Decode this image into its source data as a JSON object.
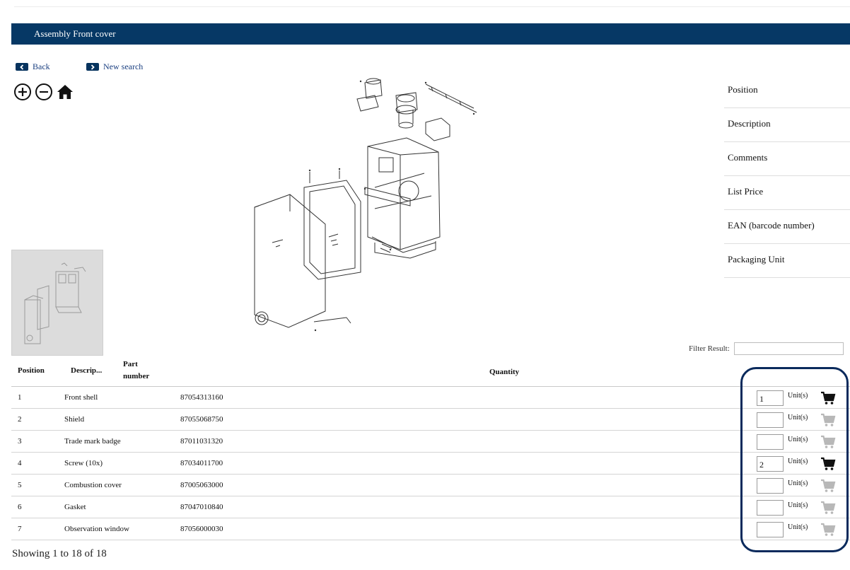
{
  "header": {
    "title": "Assembly Front cover"
  },
  "nav": {
    "back_label": "Back",
    "new_search_label": "New search"
  },
  "toolbar": {
    "zoom_in_icon": "circle-plus-icon",
    "zoom_out_icon": "circle-minus-icon",
    "home_icon": "home-icon"
  },
  "details": {
    "labels": [
      "Position",
      "Description",
      "Comments",
      "List Price",
      "EAN (barcode number)",
      "Packaging Unit"
    ]
  },
  "filter": {
    "label": "Filter Result:",
    "value": ""
  },
  "table": {
    "headers": {
      "position": "Position",
      "description": "Descrip...",
      "part_number_line1": "Part",
      "part_number_line2": "number",
      "quantity": "Quantity"
    },
    "rows": [
      {
        "position": "1",
        "description": "Front shell",
        "part_number": "87054313160",
        "quantity": "1",
        "unit": "Unit(s)",
        "cart_active": true
      },
      {
        "position": "2",
        "description": "Shield",
        "part_number": "87055068750",
        "quantity": "",
        "unit": "Unit(s)",
        "cart_active": false
      },
      {
        "position": "3",
        "description": "Trade mark badge",
        "part_number": "87011031320",
        "quantity": "",
        "unit": "Unit(s)",
        "cart_active": false
      },
      {
        "position": "4",
        "description": "Screw (10x)",
        "part_number": "87034011700",
        "quantity": "2",
        "unit": "Unit(s)",
        "cart_active": true
      },
      {
        "position": "5",
        "description": "Combustion cover",
        "part_number": "87005063000",
        "quantity": "",
        "unit": "Unit(s)",
        "cart_active": false
      },
      {
        "position": "6",
        "description": "Gasket",
        "part_number": "87047010840",
        "quantity": "",
        "unit": "Unit(s)",
        "cart_active": false
      },
      {
        "position": "7",
        "description": "Observation window",
        "part_number": "87056000030",
        "quantity": "",
        "unit": "Unit(s)",
        "cart_active": false
      }
    ]
  },
  "footer": {
    "showing": "Showing 1 to 18 of 18"
  },
  "colors": {
    "header_bg": "#063865",
    "cart_active": "#111111",
    "cart_inactive": "#b8b8b8",
    "highlight": "#0a2a5c"
  }
}
